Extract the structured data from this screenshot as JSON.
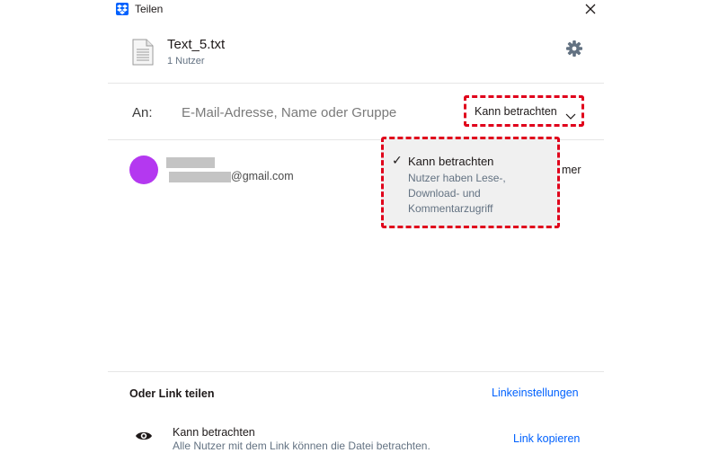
{
  "window": {
    "title": "Teilen",
    "app_icon": "dropbox-icon",
    "close_icon": "close-icon"
  },
  "file": {
    "name": "Text_5.txt",
    "meta": "1 Nutzer",
    "file_icon": "text-file-icon",
    "settings_icon": "gear-icon"
  },
  "share": {
    "to_label": "An:",
    "input_placeholder": "E-Mail-Adresse, Name oder Gruppe",
    "input_value": "",
    "permission_selected": "Kann betrachten"
  },
  "member": {
    "email_suffix": "@gmail.com",
    "role_partial": "mer",
    "avatar_color": "#b438f0"
  },
  "dropdown_menu": {
    "options": [
      {
        "title": "Kann betrachten",
        "description": "Nutzer haben Lese-, Download- und Kommentarzugriff",
        "selected": true
      }
    ]
  },
  "link_share": {
    "section_title": "Oder Link teilen",
    "settings_label": "Linkeinstellungen",
    "permission_title": "Kann betrachten",
    "permission_desc": "Alle Nutzer mit dem Link können die Datei betrachten.",
    "copy_label": "Link kopieren",
    "icon": "eye-icon"
  },
  "colors": {
    "accent": "#0061fe",
    "highlight": "#e0001b",
    "secondary_text": "#637282"
  }
}
